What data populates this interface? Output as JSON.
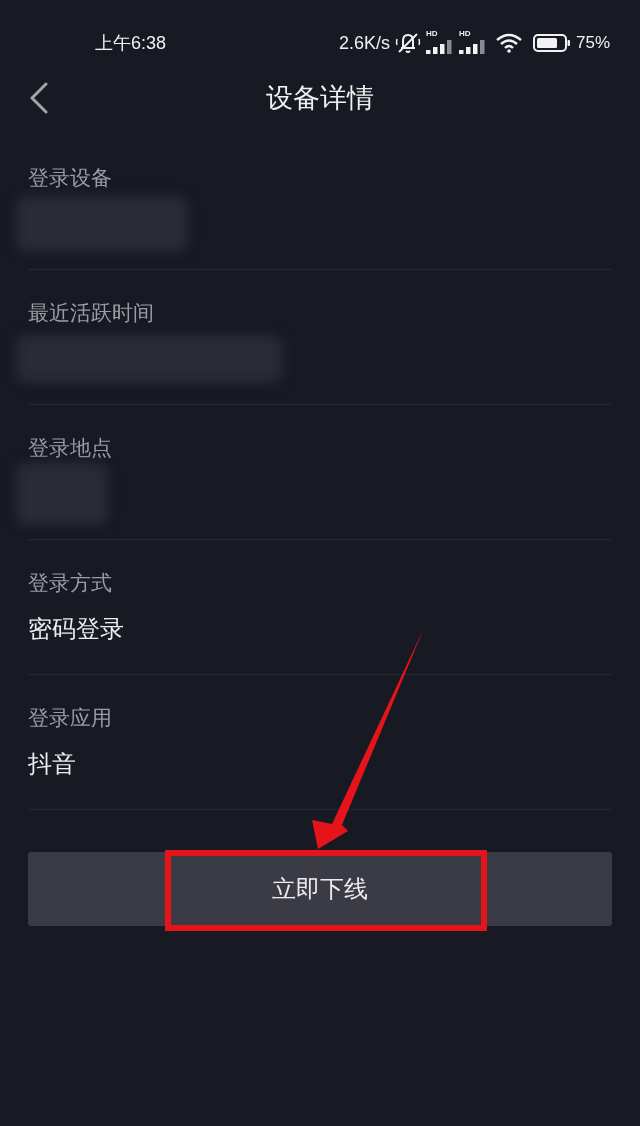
{
  "status_bar": {
    "time": "上午6:38",
    "net_speed": "2.6K/s",
    "signals": [
      {
        "badge": "HD"
      },
      {
        "badge": "HD"
      }
    ],
    "battery_text": "75%"
  },
  "nav": {
    "title": "设备详情"
  },
  "fields": [
    {
      "label": "登录设备",
      "kind": "redacted"
    },
    {
      "label": "最近活跃时间",
      "kind": "redacted"
    },
    {
      "label": "登录地点",
      "kind": "redacted"
    },
    {
      "label": "登录方式",
      "kind": "text",
      "value": "密码登录"
    },
    {
      "label": "登录应用",
      "kind": "text",
      "value": "抖音"
    }
  ],
  "button": {
    "label": "立即下线"
  },
  "annotations": {
    "pointer_arrow": true,
    "highlight_frame": true
  }
}
